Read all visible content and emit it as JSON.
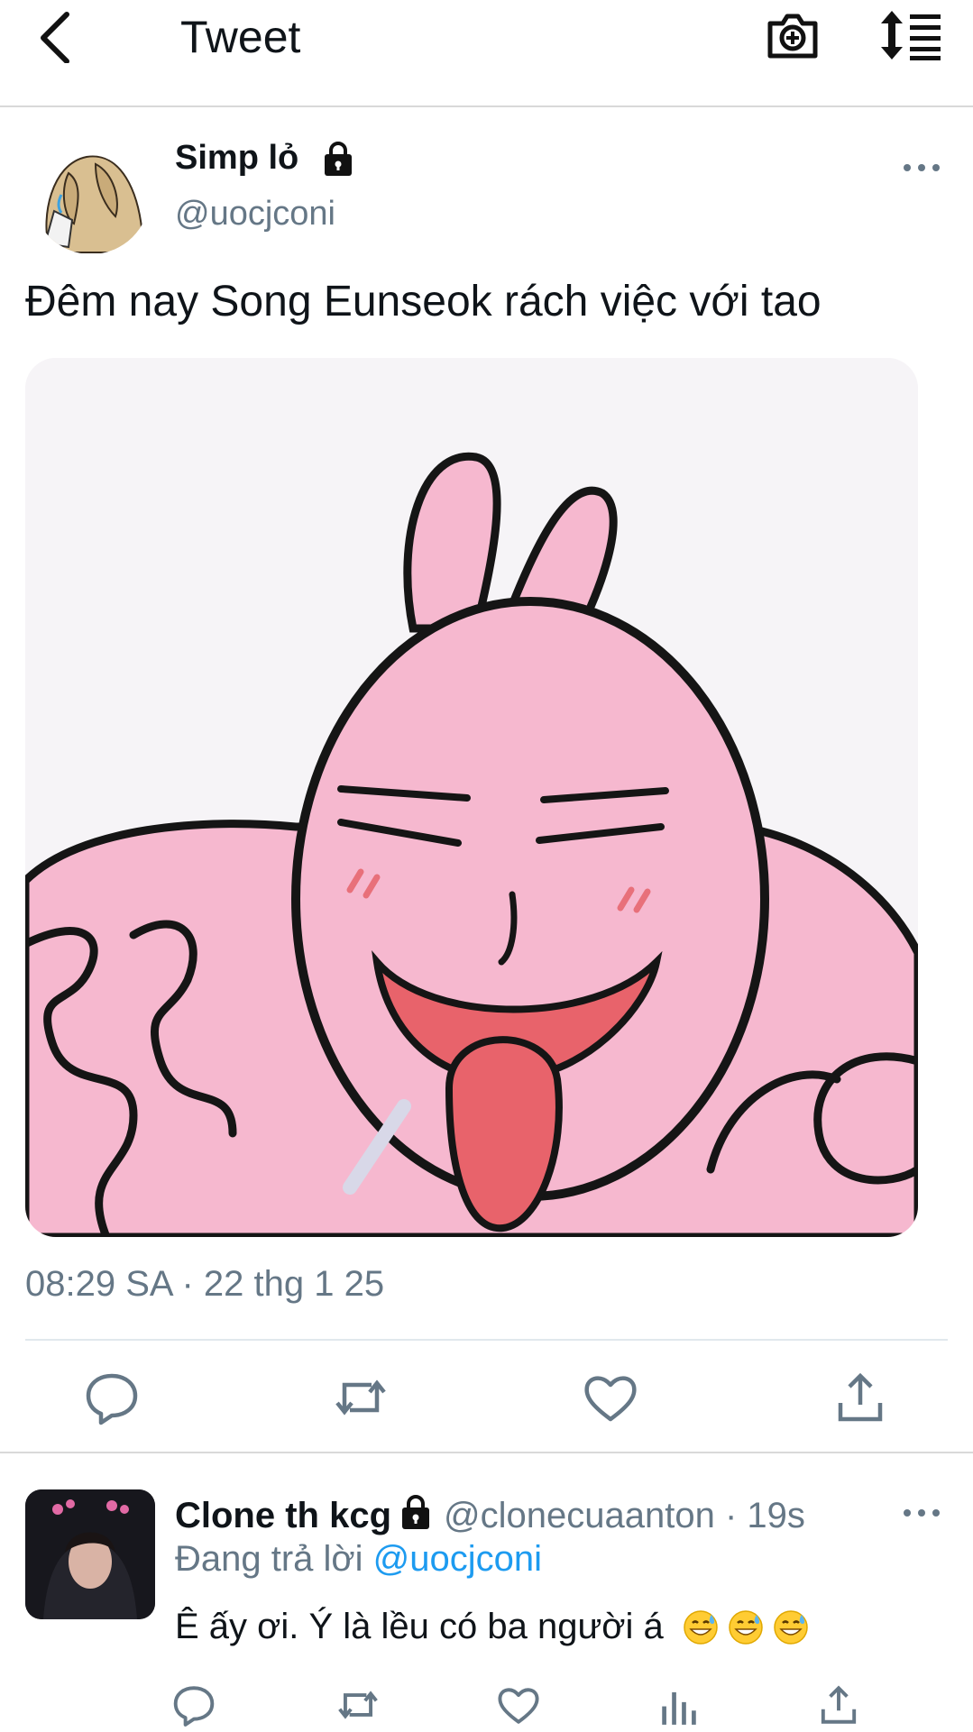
{
  "header": {
    "title": "Tweet",
    "back_icon": "chevron-left-icon",
    "camera_icon": "camera-add-icon",
    "sort_icon": "sort-icon"
  },
  "tweet": {
    "author_name": "Simp lỏ",
    "author_handle": "@uocjconi",
    "text": "Đêm nay Song Eunseok rách việc với tao",
    "timestamp": "08:29 SA · 22 thg 1 25",
    "actions": [
      "reply-icon",
      "retweet-icon",
      "like-icon",
      "share-icon"
    ]
  },
  "reply": {
    "author_name": "Clone th kcg",
    "author_handle": "@clonecuaanton",
    "time": "· 19s",
    "replying_label": "Đang trả lời",
    "replying_to": "@uocjconi",
    "text": "Ê ấy ơi. Ý là lều có ba người á",
    "emoji_count": 3,
    "actions": [
      "reply-icon",
      "retweet-icon",
      "like-icon",
      "analytics-icon",
      "share-icon"
    ]
  },
  "colors": {
    "text": "#0f1419",
    "secondary": "#657786",
    "accent": "#1d9bf0",
    "media_pink": "#f6b8cf"
  }
}
